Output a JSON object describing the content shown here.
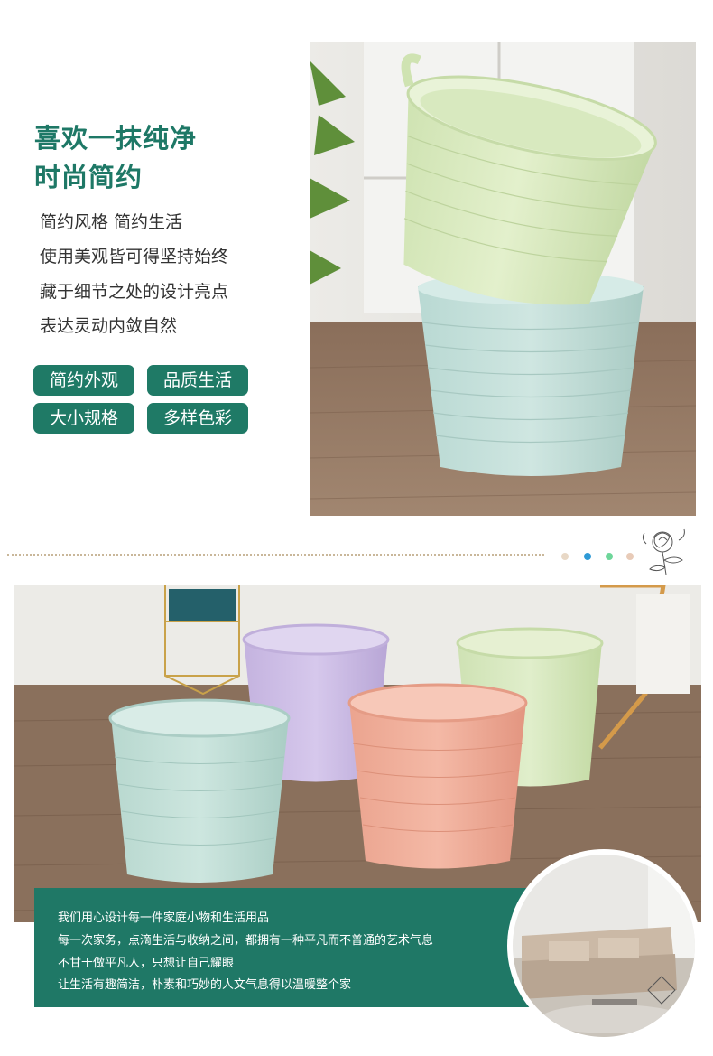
{
  "intro": {
    "title_line1": "喜欢一抹纯净",
    "title_line2": "时尚简约",
    "desc_lines": [
      "简约风格 简约生活",
      "使用美观皆可得坚持始终",
      "藏于细节之处的设计亮点",
      "表达灵动内敛自然"
    ]
  },
  "tags": [
    "简约外观",
    "品质生活",
    "大小规格",
    "多样色彩"
  ],
  "colors": {
    "accent": "#1f7a66",
    "dots": [
      "#e8d8c6",
      "#2e9ad6",
      "#6ed69a",
      "#e8cbb8"
    ]
  },
  "bottom_text": [
    "我们用心设计每一件家庭小物和生活用品",
    "每一次家务，点滴生活与收纳之间，都拥有一种平凡而不普通的艺术气息",
    "不甘于做平凡人，只想让自己耀眼",
    "让生活有趣简洁，朴素和巧妙的人文气息得以温暖整个家"
  ],
  "images": {
    "photo_top": "two-stacked-tubs-photo",
    "photo_bottom": "four-colored-tubs-photo",
    "circle": "living-room-sofa-photo",
    "flower": "flower-sketch-icon"
  }
}
